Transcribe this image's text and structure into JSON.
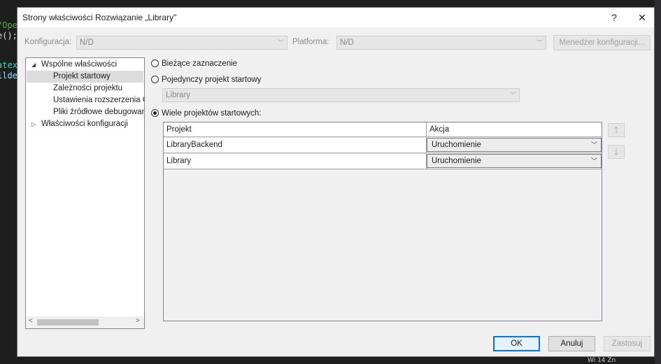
{
  "background": {
    "code_fragments": [
      "/Ope",
      "e();",
      "atex",
      "ilde"
    ],
    "status_text": "Wi 14   Zn"
  },
  "dialog": {
    "title": "Strony właściwości Rozwiązanie „Library\"",
    "help_label": "?",
    "close_label": "✕"
  },
  "config_bar": {
    "configuration_label": "Konfiguracja:",
    "configuration_value": "N/D",
    "platform_label": "Platforma:",
    "platform_value": "N/D",
    "manager_button": "Menedżer konfiguracji..."
  },
  "tree": {
    "items": [
      {
        "label": "Wspólne właściwości",
        "expander": "◢"
      },
      {
        "label": "Projekt startowy"
      },
      {
        "label": "Zależności projektu"
      },
      {
        "label": "Ustawienia rozszerzenia Co"
      },
      {
        "label": "Pliki źródłowe debugowan"
      },
      {
        "label": "Właściwości konfiguracji",
        "expander": "▷"
      }
    ],
    "scroll_left": "<",
    "scroll_right": ">"
  },
  "startup": {
    "current_selection": "Bieżące zaznaczenie",
    "single_project": "Pojedynczy projekt startowy",
    "single_project_value": "Library",
    "multiple_projects": "Wiele projektów startowych:"
  },
  "grid": {
    "columns": [
      "Projekt",
      "Akcja"
    ],
    "rows": [
      {
        "project": "LibraryBackend",
        "action": "Uruchomienie"
      },
      {
        "project": "Library",
        "action": "Uruchomienie"
      }
    ],
    "move_up": "🡑",
    "move_down": "🡓"
  },
  "buttons": {
    "ok": "OK",
    "cancel": "Anuluj",
    "apply": "Zastosuj"
  }
}
